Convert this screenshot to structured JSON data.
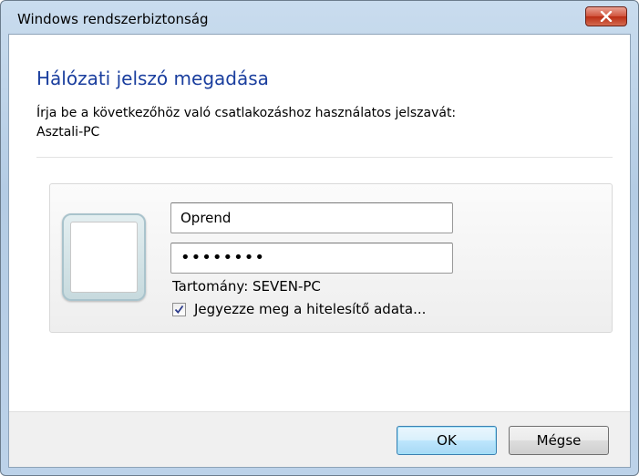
{
  "window": {
    "title": "Windows rendszerbiztonság",
    "close_icon": "close-x-icon"
  },
  "dialog": {
    "heading": "Hálózati jelszó megadása",
    "instruction": "Írja be a következőhöz való csatlakozáshoz használatos jelszavát:",
    "target": "Asztali-PC"
  },
  "credentials": {
    "avatar_icon": "user-tile-icon",
    "username_value": "Oprend",
    "password_value": "••••••••",
    "domain_label": "Tartomány: SEVEN-PC",
    "remember_label": "Jegyezze meg a hitelesítő adata...",
    "remember_checked": true
  },
  "buttons": {
    "ok_label": "OK",
    "cancel_label": "Mégse"
  },
  "colors": {
    "heading": "#1a3e9e",
    "close_button": "#c94a33",
    "default_button_border": "#3c7fb1"
  }
}
